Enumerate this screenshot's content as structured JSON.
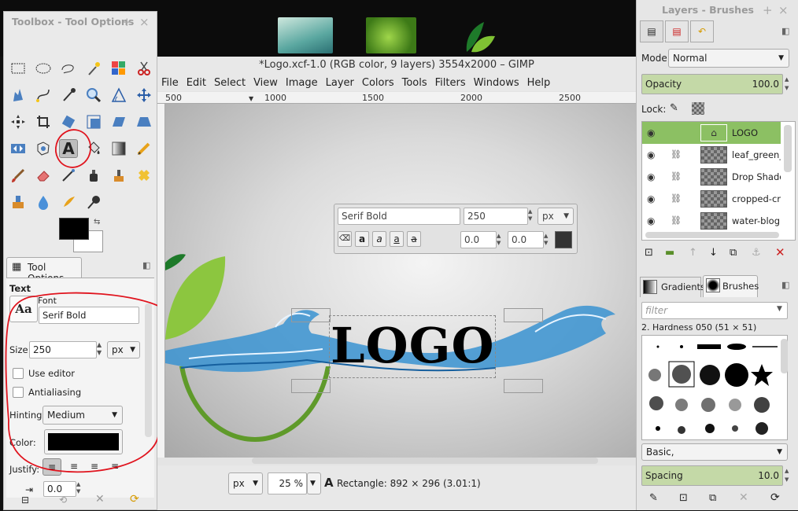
{
  "toolbox": {
    "title": "Toolbox - Tool Options",
    "tool_options_tab": "Tool Options",
    "section": "Text",
    "font_label": "Font",
    "font_preview": "Aa",
    "font_value": "Serif Bold",
    "size_label": "Size:",
    "size_value": "250",
    "size_unit": "px",
    "use_editor_label": "Use editor",
    "antialiasing_label": "Antialiasing",
    "hinting_label": "Hinting:",
    "hinting_value": "Medium",
    "color_label": "Color:",
    "color_value": "#000000",
    "justify_label": "Justify:",
    "indent_value": "0.0",
    "annotation_color": "#e0141e"
  },
  "window": {
    "title": "*Logo.xcf-1.0 (RGB color, 9 layers) 3554x2000 – GIMP",
    "menu": [
      "File",
      "Edit",
      "Select",
      "View",
      "Image",
      "Layer",
      "Colors",
      "Tools",
      "Filters",
      "Windows",
      "Help"
    ],
    "ruler_ticks": [
      "500",
      "1000",
      "1500",
      "2000",
      "2500"
    ]
  },
  "canvas": {
    "logo_text": "LOGO",
    "text_toolbar": {
      "font": "Serif Bold",
      "size": "250",
      "unit": "px",
      "baseline": "0.0",
      "kerning": "0.0"
    }
  },
  "status": {
    "unit": "px",
    "zoom": "25 %",
    "message": "Rectangle: 892 × 296 (3.01:1)"
  },
  "dock": {
    "title": "Layers - Brushes",
    "mode_label": "Mode:",
    "mode_value": "Normal",
    "opacity_label": "Opacity",
    "opacity_value": "100.0",
    "lock_label": "Lock:",
    "layers": [
      "LOGO",
      "leaf_green_d",
      "Drop Shadow",
      "cropped-crop",
      "water-blog.jp"
    ],
    "tabs": [
      "Gradients",
      "Brushes"
    ],
    "filter_placeholder": "filter",
    "brush_name": "2. Hardness 050 (51 × 51)",
    "brush_set": "Basic,",
    "spacing_label": "Spacing",
    "spacing_value": "10.0"
  }
}
